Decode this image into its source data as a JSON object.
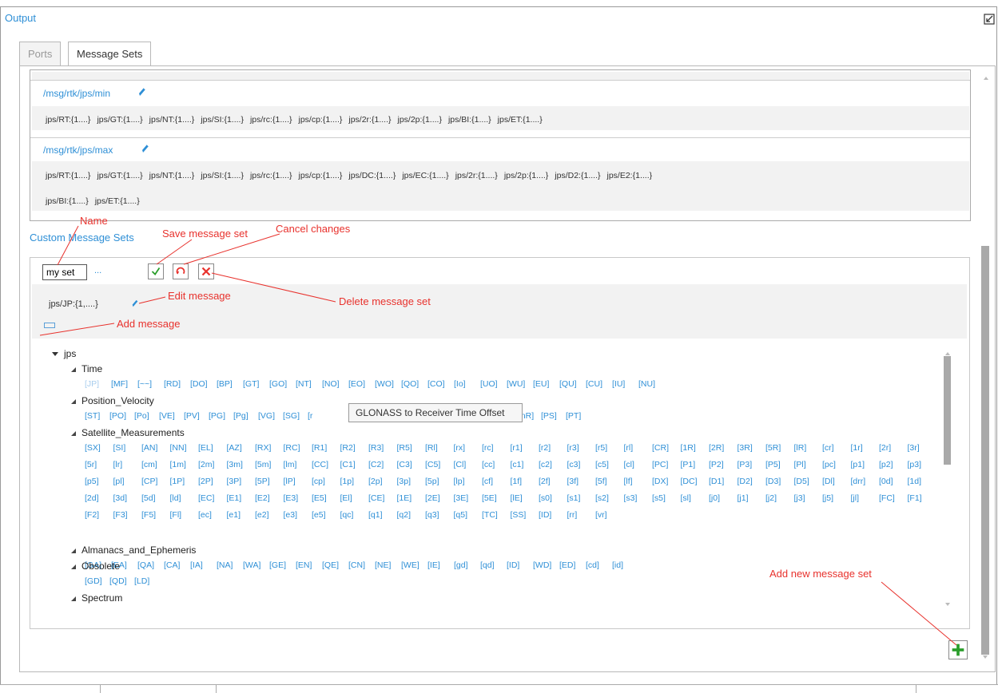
{
  "window": {
    "title": "Output"
  },
  "tabs": [
    {
      "label": "Ports"
    },
    {
      "label": "Message Sets"
    }
  ],
  "message_sets": [
    {
      "name": "/msg/rtk/jps/min",
      "lines": [
        [
          "jps/RT:{1....}",
          "jps/GT:{1....}",
          "jps/NT:{1....}",
          "jps/SI:{1....}",
          "jps/rc:{1....}",
          "jps/cp:{1....}",
          "jps/2r:{1....}",
          "jps/2p:{1....}",
          "jps/BI:{1....}",
          "jps/ET:{1....}"
        ]
      ]
    },
    {
      "name": "/msg/rtk/jps/max",
      "lines": [
        [
          "jps/RT:{1....}",
          "jps/GT:{1....}",
          "jps/NT:{1....}",
          "jps/SI:{1....}",
          "jps/rc:{1....}",
          "jps/cp:{1....}",
          "jps/DC:{1....}",
          "jps/EC:{1....}",
          "jps/2r:{1....}",
          "jps/2p:{1....}",
          "jps/D2:{1....}",
          "jps/E2:{1....}"
        ],
        [
          "jps/BI:{1....}",
          "jps/ET:{1....}"
        ]
      ]
    }
  ],
  "custom": {
    "label": "Custom Message Sets",
    "name_value": "my set",
    "dots": "...",
    "message": "jps/JP:{1,....}"
  },
  "tree": {
    "root": "jps",
    "groups": [
      {
        "name": "Time",
        "rows": [
          [
            "[JP]",
            "[MF]",
            "[~~]",
            "[RD]",
            "[DO]",
            "[BP]",
            "[GT]",
            "[GO]",
            "[NT]",
            "[NO]",
            "[EO]",
            "[WO]",
            "[QO]",
            "[CO]",
            "[Io]",
            "[UO]",
            "[WU]",
            "[EU]",
            "[QU]",
            "[CU]",
            "[IU]",
            "[NU]"
          ]
        ]
      },
      {
        "name": "Position_Velocity",
        "rows": [
          [
            "[ST]",
            "[PO]",
            "[Po]",
            "[VE]",
            "[PV]",
            "[PG]",
            "[Pg]",
            "[VG]",
            "[SG]",
            "[r",
            "[mR]",
            "[PS]",
            "[PT]"
          ]
        ]
      },
      {
        "name": "Satellite_Measurements",
        "rows": [
          [
            "[SX]",
            "[SI]",
            "[AN]",
            "[NN]",
            "[EL]",
            "[AZ]",
            "[RX]",
            "[RC]",
            "[R1]",
            "[R2]",
            "[R3]",
            "[R5]",
            "[Rl]",
            "[rx]",
            "[rc]",
            "[r1]",
            "[r2]",
            "[r3]",
            "[r5]",
            "[rl]",
            "[CR]",
            "[1R]",
            "[2R]",
            "[3R]",
            "[5R]",
            "[lR]",
            "[cr]",
            "[1r]",
            "[2r]",
            "[3r]"
          ],
          [
            "[5r]",
            "[lr]",
            "[cm]",
            "[1m]",
            "[2m]",
            "[3m]",
            "[5m]",
            "[lm]",
            "[CC]",
            "[C1]",
            "[C2]",
            "[C3]",
            "[C5]",
            "[Cl]",
            "[cc]",
            "[c1]",
            "[c2]",
            "[c3]",
            "[c5]",
            "[cl]",
            "[PC]",
            "[P1]",
            "[P2]",
            "[P3]",
            "[P5]",
            "[Pl]",
            "[pc]",
            "[p1]",
            "[p2]",
            "[p3]"
          ],
          [
            "[p5]",
            "[pl]",
            "[CP]",
            "[1P]",
            "[2P]",
            "[3P]",
            "[5P]",
            "[lP]",
            "[cp]",
            "[1p]",
            "[2p]",
            "[3p]",
            "[5p]",
            "[lp]",
            "[cf]",
            "[1f]",
            "[2f]",
            "[3f]",
            "[5f]",
            "[lf]",
            "[DX]",
            "[DC]",
            "[D1]",
            "[D2]",
            "[D3]",
            "[D5]",
            "[Dl]",
            "[drr]",
            "[0d]",
            "[1d]"
          ],
          [
            "[2d]",
            "[3d]",
            "[5d]",
            "[ld]",
            "[EC]",
            "[E1]",
            "[E2]",
            "[E3]",
            "[E5]",
            "[El]",
            "[CE]",
            "[1E]",
            "[2E]",
            "[3E]",
            "[5E]",
            "[lE]",
            "[s0]",
            "[s1]",
            "[s2]",
            "[s3]",
            "[s5]",
            "[sl]",
            "[j0]",
            "[j1]",
            "[j2]",
            "[j3]",
            "[j5]",
            "[jl]",
            "[FC]",
            "[F1]"
          ],
          [
            "[F2]",
            "[F3]",
            "[F5]",
            "[Fl]",
            "[ec]",
            "[e1]",
            "[e2]",
            "[e3]",
            "[e5]",
            "[qc]",
            "[q1]",
            "[q2]",
            "[q3]",
            "[q5]",
            "[TC]",
            "[SS]",
            "[ID]",
            "[rr]",
            "[vr]"
          ]
        ]
      },
      {
        "name": "Almanacs_and_Ephemeris",
        "rows": [
          [
            "[GA]",
            "[EA]",
            "[QA]",
            "[CA]",
            "[IA]",
            "[NA]",
            "[WA]",
            "[GE]",
            "[EN]",
            "[QE]",
            "[CN]",
            "[NE]",
            "[WE]",
            "[IE]",
            "[gd]",
            "[qd]",
            "[ID]",
            "[WD]",
            "[ED]",
            "[cd]",
            "[id]"
          ]
        ]
      },
      {
        "name": "Obsolete",
        "rows": [
          [
            "[GD]",
            "[QD]",
            "[LD]"
          ]
        ]
      },
      {
        "name": "Spectrum",
        "rows": []
      }
    ]
  },
  "tooltip": "GLONASS to Receiver Time Offset",
  "annotations": {
    "name": "Name",
    "save": "Save message set",
    "cancel": "Cancel changes",
    "edit": "Edit message",
    "delete": "Delete message set",
    "add_message": "Add message",
    "add_set": "Add new message set"
  },
  "colors": {
    "accent": "#2e8fd6",
    "annotation": "#e8322d",
    "ok": "#2a9d2a"
  }
}
